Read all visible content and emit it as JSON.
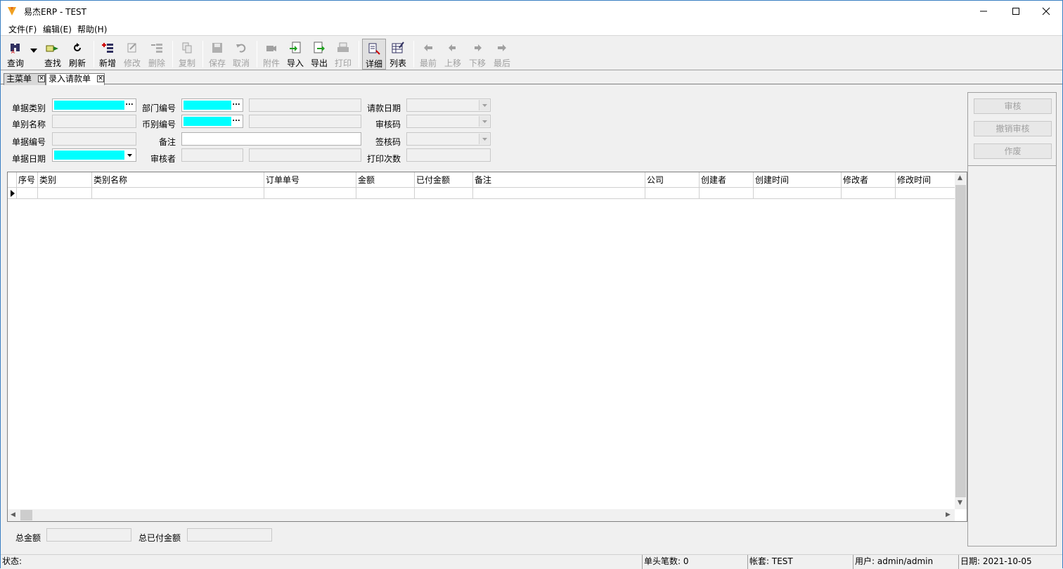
{
  "window": {
    "title": "易杰ERP - TEST"
  },
  "menu": [
    "文件(F)",
    "编辑(E)",
    "帮助(H)"
  ],
  "toolbar": {
    "query": "查询",
    "find": "查找",
    "refresh": "刷新",
    "add": "新增",
    "edit": "修改",
    "delete": "删除",
    "copy": "复制",
    "save": "保存",
    "cancel": "取消",
    "attach": "附件",
    "import": "导入",
    "export": "导出",
    "print": "打印",
    "detail": "详细",
    "list": "列表",
    "first": "最前",
    "prev": "上移",
    "next": "下移",
    "last": "最后"
  },
  "tabs": [
    "主菜单",
    "录入请款单"
  ],
  "form": {
    "doc_type": "单据类别",
    "doc_name": "单别名称",
    "doc_no": "单据编号",
    "doc_date": "单据日期",
    "dept_no": "部门编号",
    "currency_no": "币别编号",
    "remark": "备注",
    "auditor": "审核者",
    "request_date": "请款日期",
    "audit_code": "审核码",
    "sign_code": "签核码",
    "print_count": "打印次数"
  },
  "actions": {
    "audit": "审核",
    "unaudit": "撤销审核",
    "void": "作废"
  },
  "grid": {
    "columns": [
      "序号",
      "类别",
      "类别名称",
      "订单单号",
      "金额",
      "已付金额",
      "备注",
      "公司",
      "创建者",
      "创建时间",
      "修改者",
      "修改时间"
    ]
  },
  "totals": {
    "total_amount": "总金额",
    "total_paid": "总已付金额"
  },
  "status": {
    "state": "状态:",
    "count": "单头笔数: 0",
    "account": "帐套: TEST",
    "user": "用户: admin/admin",
    "date": "日期: 2021-10-05"
  },
  "colors": {
    "required_field": "#00ffff",
    "accent_border": "#3a7fc2"
  }
}
